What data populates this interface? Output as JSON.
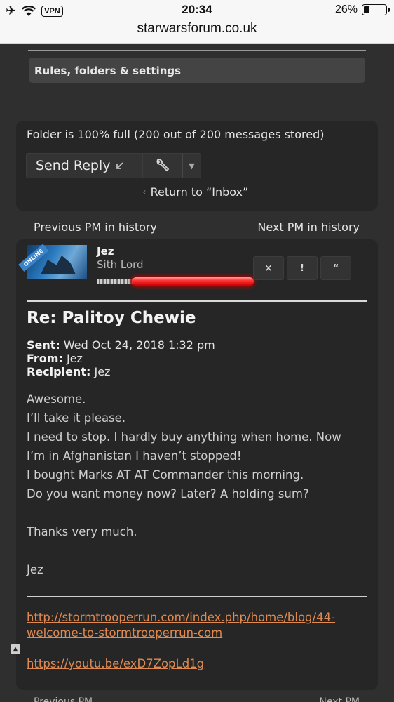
{
  "status_bar": {
    "vpn": "VPN",
    "time": "20:34",
    "battery_percent": "26%",
    "battery_level": 0.26
  },
  "browser": {
    "url": "starwarsforum.co.uk"
  },
  "rules_bar": {
    "label": "Rules, folders & settings"
  },
  "folder": {
    "status_text": "Folder is 100% full (200 out of 200 messages stored)",
    "send_reply": "Send Reply",
    "return_link": "Return to “Inbox”"
  },
  "history": {
    "previous": "Previous PM in history",
    "next": "Next PM in history"
  },
  "message": {
    "author": "Jez",
    "rank": "Sith Lord",
    "online_badge": "ONLINE",
    "buttons": {
      "delete": "×",
      "report": "!",
      "quote": "“"
    },
    "subject": "Re: Palitoy Chewie",
    "sent_label": "Sent:",
    "sent_value": "Wed Oct 24, 2018 1:32 pm",
    "from_label": "From:",
    "from_value": "Jez",
    "recipient_label": "Recipient:",
    "recipient_value": "Jez",
    "body": [
      "Awesome.",
      "I’ll take it please.",
      "I need to stop. I hardly buy anything when home. Now",
      "I’m in Afghanistan I haven’t stopped!",
      "I bought Marks AT AT Commander this morning.",
      "Do you want money now? Later? A holding sum?",
      "Thanks very much.",
      "Jez"
    ],
    "links": [
      "http://stormtrooperrun.com/index.php/home/blog/44-",
      "welcome-to-stormtrooperrun-com",
      "https://youtu.be/exD7ZopLd1g"
    ]
  },
  "bottom_nav": {
    "previous": "Previous PM",
    "next": "Next PM"
  }
}
